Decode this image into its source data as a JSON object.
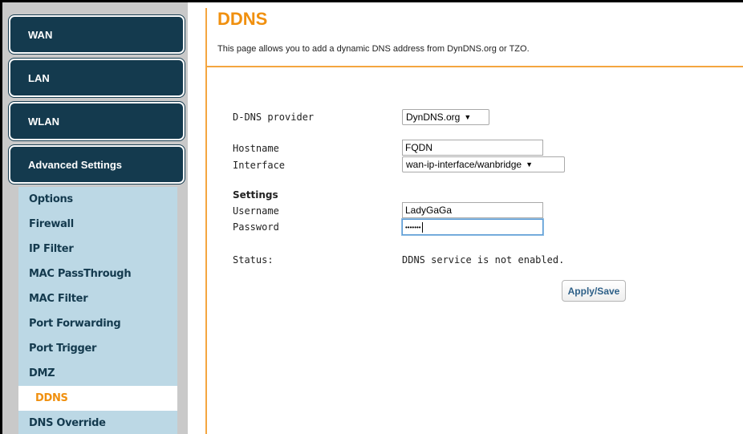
{
  "sidebar": {
    "main_items": [
      {
        "label": "WAN"
      },
      {
        "label": "LAN"
      },
      {
        "label": "WLAN"
      },
      {
        "label": "Advanced Settings"
      }
    ],
    "sub_items": [
      {
        "label": "Options"
      },
      {
        "label": "Firewall"
      },
      {
        "label": "IP Filter"
      },
      {
        "label": "MAC PassThrough"
      },
      {
        "label": "MAC Filter"
      },
      {
        "label": "Port Forwarding"
      },
      {
        "label": "Port Trigger"
      },
      {
        "label": "DMZ"
      },
      {
        "label": "DDNS",
        "active": true
      },
      {
        "label": "DNS Override"
      }
    ]
  },
  "page": {
    "title": "DDNS",
    "description": "This page allows you to add a dynamic DNS address from DynDNS.org or TZO."
  },
  "form": {
    "provider_label": "D-DNS provider",
    "provider_value": "DynDNS.org",
    "hostname_label": "Hostname",
    "hostname_value": "FQDN",
    "interface_label": "Interface",
    "interface_value": "wan-ip-interface/wanbridge",
    "settings_heading": "Settings",
    "username_label": "Username",
    "username_value": "LadyGaGa",
    "password_label": "Password",
    "password_masked": "•••••••",
    "status_label": "Status:",
    "status_value": "DDNS service is not enabled.",
    "apply_label": "Apply/Save"
  },
  "colors": {
    "nav_dark": "#143a4e",
    "accent_orange": "#f0900f",
    "submenu_bg": "#bcd8e5",
    "sidebar_gray": "#c9c9c9"
  }
}
